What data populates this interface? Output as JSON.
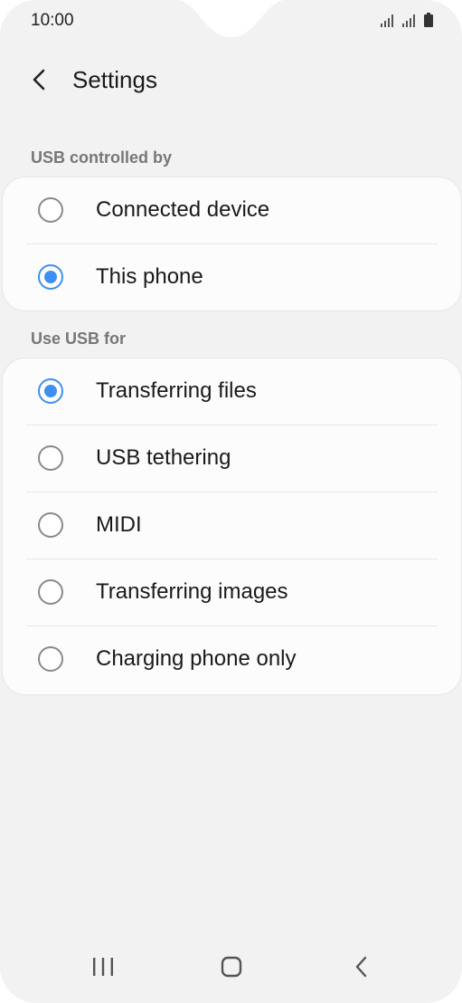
{
  "status_bar": {
    "time": "10:00"
  },
  "header": {
    "title": "Settings"
  },
  "sections": [
    {
      "label": "USB controlled by",
      "options": [
        {
          "label": "Connected device",
          "selected": false
        },
        {
          "label": "This phone",
          "selected": true
        }
      ]
    },
    {
      "label": "Use USB for",
      "options": [
        {
          "label": "Transferring files",
          "selected": true
        },
        {
          "label": "USB tethering",
          "selected": false
        },
        {
          "label": "MIDI",
          "selected": false
        },
        {
          "label": "Transferring images",
          "selected": false
        },
        {
          "label": "Charging phone only",
          "selected": false
        }
      ]
    }
  ],
  "colors": {
    "accent": "#3e8ff2",
    "background": "#f2f2f2",
    "card": "#fcfcfc"
  },
  "icons": {
    "back": "chevron-left-icon",
    "recents": "recents-icon",
    "home": "home-icon",
    "nav_back": "back-icon",
    "signal": "signal-icon",
    "battery": "battery-icon"
  }
}
